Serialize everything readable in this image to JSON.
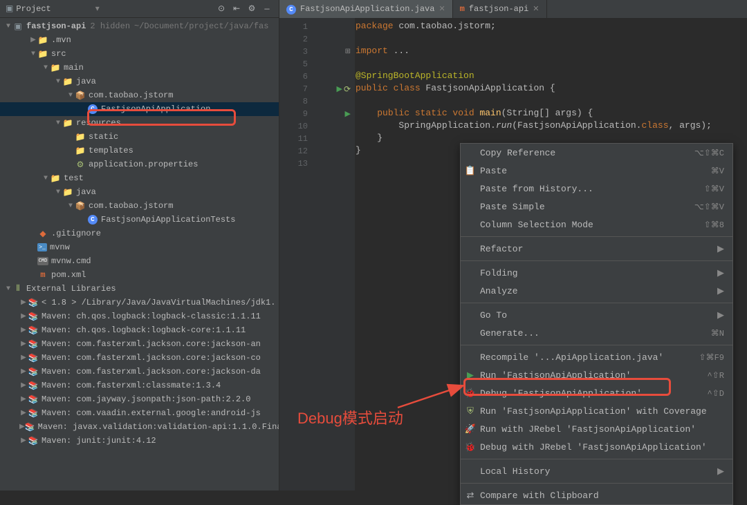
{
  "sidebar": {
    "title": "Project",
    "root": {
      "name": "fastjson-api",
      "hint1": "2 hidden",
      "hint2": "~/Document/project/java/fas"
    },
    "items": [
      {
        "indent": 2,
        "arrow": "▶",
        "icon": "folder",
        "label": ".mvn"
      },
      {
        "indent": 2,
        "arrow": "▼",
        "icon": "folder-blue",
        "label": "src"
      },
      {
        "indent": 3,
        "arrow": "▼",
        "icon": "folder-blue",
        "label": "main"
      },
      {
        "indent": 4,
        "arrow": "▼",
        "icon": "folder-blue",
        "label": "java"
      },
      {
        "indent": 5,
        "arrow": "▼",
        "icon": "pkg",
        "label": "com.taobao.jstorm"
      },
      {
        "indent": 6,
        "arrow": "",
        "icon": "class",
        "label": "FastjsonApiApplication",
        "selected": true
      },
      {
        "indent": 4,
        "arrow": "▼",
        "icon": "folder-res",
        "label": "resources"
      },
      {
        "indent": 5,
        "arrow": "",
        "icon": "folder-res",
        "label": "static"
      },
      {
        "indent": 5,
        "arrow": "",
        "icon": "folder-res",
        "label": "templates"
      },
      {
        "indent": 5,
        "arrow": "",
        "icon": "props",
        "label": "application.properties"
      },
      {
        "indent": 3,
        "arrow": "▼",
        "icon": "folder-blue",
        "label": "test"
      },
      {
        "indent": 4,
        "arrow": "▼",
        "icon": "folder-blue",
        "label": "java"
      },
      {
        "indent": 5,
        "arrow": "▼",
        "icon": "pkg",
        "label": "com.taobao.jstorm"
      },
      {
        "indent": 6,
        "arrow": "",
        "icon": "class",
        "label": "FastjsonApiApplicationTests"
      },
      {
        "indent": 2,
        "arrow": "",
        "icon": "gitignore",
        "label": ".gitignore"
      },
      {
        "indent": 2,
        "arrow": "",
        "icon": "mvnw",
        "label": "mvnw"
      },
      {
        "indent": 2,
        "arrow": "",
        "icon": "cmd",
        "label": "mvnw.cmd"
      },
      {
        "indent": 2,
        "arrow": "",
        "icon": "pom",
        "label": "pom.xml"
      }
    ],
    "external": {
      "title": "External Libraries",
      "items": [
        "< 1.8 >  /Library/Java/JavaVirtualMachines/jdk1.",
        "Maven: ch.qos.logback:logback-classic:1.1.11",
        "Maven: ch.qos.logback:logback-core:1.1.11",
        "Maven: com.fasterxml.jackson.core:jackson-an",
        "Maven: com.fasterxml.jackson.core:jackson-co",
        "Maven: com.fasterxml.jackson.core:jackson-da",
        "Maven: com.fasterxml:classmate:1.3.4",
        "Maven: com.jayway.jsonpath:json-path:2.2.0",
        "Maven: com.vaadin.external.google:android-js",
        "Maven: javax.validation:validation-api:1.1.0.Fina",
        "Maven: junit:junit:4.12"
      ]
    }
  },
  "tabs": [
    {
      "label": "FastjsonApiApplication.java",
      "icon": "class",
      "active": true
    },
    {
      "label": "fastjson-api",
      "icon": "pom",
      "active": false
    }
  ],
  "code": {
    "lines": [
      {
        "n": "1",
        "content": "package com.taobao.jstorm;",
        "tokens": [
          [
            "kw",
            "package "
          ],
          [
            "type",
            "com.taobao.jstorm"
          ],
          [
            "type",
            ";"
          ]
        ]
      },
      {
        "n": "2",
        "content": ""
      },
      {
        "n": "3",
        "content": "import ...",
        "fold": true,
        "tokens": [
          [
            "kw",
            "import "
          ],
          [
            "type",
            "..."
          ]
        ]
      },
      {
        "n": "5",
        "content": ""
      },
      {
        "n": "6",
        "content": "@SpringBootApplication",
        "tokens": [
          [
            "anno",
            "@SpringBootApplication"
          ]
        ]
      },
      {
        "n": "7",
        "content": "public class FastjsonApiApplication {",
        "tokens": [
          [
            "kw",
            "public class "
          ],
          [
            "type",
            "FastjsonApiApplication {"
          ]
        ],
        "gutter": "cluster"
      },
      {
        "n": "8",
        "content": ""
      },
      {
        "n": "9",
        "content": "    public static void main(String[] args) {",
        "tokens": [
          [
            "type",
            "    "
          ],
          [
            "kw",
            "public static void "
          ],
          [
            "method",
            "main"
          ],
          [
            "type",
            "(String[] args) {"
          ]
        ],
        "gutter": "run"
      },
      {
        "n": "10",
        "content": "        SpringApplication.run(FastjsonApiApplication.class, args);",
        "tokens": [
          [
            "type",
            "        SpringApplication."
          ],
          [
            "ital",
            "run"
          ],
          [
            "type",
            "(FastjsonApiApplication."
          ],
          [
            "kw",
            "class"
          ],
          [
            "type",
            ", args);"
          ]
        ]
      },
      {
        "n": "11",
        "content": "    }",
        "tokens": [
          [
            "type",
            "    }"
          ]
        ]
      },
      {
        "n": "12",
        "content": "}",
        "tokens": [
          [
            "type",
            "}"
          ]
        ]
      },
      {
        "n": "13",
        "content": ""
      }
    ]
  },
  "context_menu": {
    "items": [
      {
        "label": "Copy Reference",
        "shortcut": "⌥⇧⌘C"
      },
      {
        "label": "Paste",
        "shortcut": "⌘V",
        "icon": "paste"
      },
      {
        "label": "Paste from History...",
        "shortcut": "⇧⌘V"
      },
      {
        "label": "Paste Simple",
        "shortcut": "⌥⇧⌘V"
      },
      {
        "label": "Column Selection Mode",
        "shortcut": "⇧⌘8"
      },
      {
        "sep": true
      },
      {
        "label": "Refactor",
        "submenu": true
      },
      {
        "sep": true
      },
      {
        "label": "Folding",
        "submenu": true
      },
      {
        "label": "Analyze",
        "submenu": true
      },
      {
        "sep": true
      },
      {
        "label": "Go To",
        "submenu": true
      },
      {
        "label": "Generate...",
        "shortcut": "⌘N"
      },
      {
        "sep": true
      },
      {
        "label": "Recompile '...ApiApplication.java'",
        "shortcut": "⇧⌘F9"
      },
      {
        "label": "Run 'FastjsonApiApplication'",
        "shortcut": "^⇧R",
        "icon": "run"
      },
      {
        "label": "Debug 'FastjsonApiApplication'",
        "shortcut": "^⇧D",
        "icon": "debug",
        "highlighted": true
      },
      {
        "label": "Run 'FastjsonApiApplication' with Coverage",
        "icon": "coverage"
      },
      {
        "label": "Run with JRebel 'FastjsonApiApplication'",
        "icon": "jrebel"
      },
      {
        "label": "Debug with JRebel 'FastjsonApiApplication'",
        "icon": "jrebel-debug"
      },
      {
        "sep": true
      },
      {
        "label": "Local History",
        "submenu": true
      },
      {
        "sep": true
      },
      {
        "label": "Compare with Clipboard",
        "icon": "compare"
      }
    ]
  },
  "annotation": {
    "text": "Debug模式启动"
  }
}
